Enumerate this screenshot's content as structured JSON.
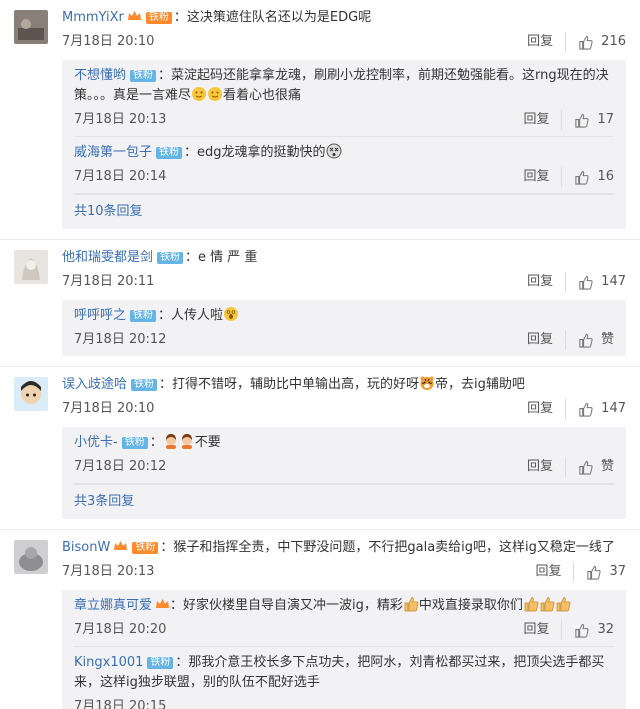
{
  "comments": [
    {
      "user": "MmmYiXr",
      "badge": "铁粉",
      "text": "这决策遮住队名还以为是EDG呢",
      "time": "7月18日 20:10",
      "reply_label": "回复",
      "likes": "216",
      "replies": [
        {
          "user": "不想懂哟",
          "badge": "铁粉",
          "text_a": "菜淀起码还能拿拿龙魂，刷刷小龙控制率，前期还勉强能看。这rng现在的决策。。。真是一言难尽",
          "text_b": "看着心也很痛",
          "time": "7月18日 20:13",
          "reply_label": "回复",
          "likes": "17"
        },
        {
          "user": "威海第一包子",
          "badge": "铁粉",
          "text_a": "edg龙魂拿的挺勤快的",
          "text_b": "",
          "time": "7月18日 20:14",
          "reply_label": "回复",
          "likes": "16"
        }
      ],
      "more": "共10条回复"
    },
    {
      "user": "他和瑞雯都是剑",
      "badge": "铁粉",
      "text": "e 情 严  重",
      "time": "7月18日 20:11",
      "reply_label": "回复",
      "likes": "147",
      "replies": [
        {
          "user": "呼呼呼之",
          "badge": "铁粉",
          "text_a": "人传人啦",
          "text_b": "",
          "time": "7月18日 20:12",
          "reply_label": "回复",
          "likes": "赞"
        }
      ]
    },
    {
      "user": "误入歧途哈",
      "badge": "铁粉",
      "text_a": "打得不错呀，辅助比中单输出高，玩的好呀",
      "text_b": "帝，去ig辅助吧",
      "time": "7月18日 20:10",
      "reply_label": "回复",
      "likes": "147",
      "replies": [
        {
          "user": "小优卡-",
          "badge": "铁粉",
          "text_a": "",
          "text_b": "不要",
          "time": "7月18日 20:12",
          "reply_label": "回复",
          "likes": "赞"
        }
      ],
      "more": "共3条回复"
    },
    {
      "user": "BisonW",
      "badge": "铁粉",
      "text": "猴子和指挥全责，中下野没问题，不行把gala卖给ig吧，这样ig又稳定一线了",
      "time": "7月18日 20:13",
      "reply_label": "回复",
      "likes": "37",
      "replies": [
        {
          "user": "章立娜真可爱",
          "text_a": "好家伙楼里自导自演又冲一波ig，精彩",
          "text_b": "中戏直接录取你们",
          "time": "7月18日 20:20",
          "reply_label": "回复",
          "likes": "32"
        },
        {
          "user": "Kingx1001",
          "badge": "铁粉",
          "text_a": "那我介意王校长多下点功夫，把阿水，刘青松都买过来，把顶尖选手都买来，这样ig独步联盟，别的队伍不配好选手",
          "text_b": "",
          "time": "7月18日 20:15",
          "reply_label": "回复",
          "likes": ""
        }
      ]
    }
  ],
  "colors": {
    "link": "#3a6eb1",
    "badge_blue": "#64b4e6",
    "badge_orange": "#ff8a2b",
    "reply_bg": "#f2f2f5"
  }
}
